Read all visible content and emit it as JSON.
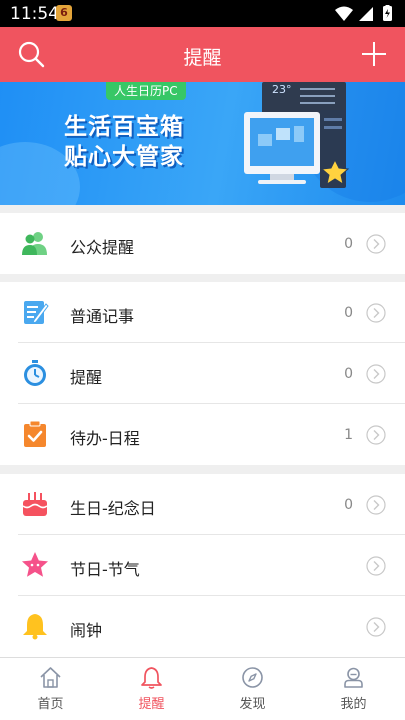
{
  "status_bar": {
    "time": "11:54",
    "notification_badge": "6"
  },
  "header": {
    "title": "提醒",
    "search_icon": "search-icon",
    "add_icon": "plus-icon"
  },
  "banner": {
    "tag": "人生日历PC",
    "line1": "生活百宝箱",
    "line2": "贴心大管家",
    "clock_text": "23°"
  },
  "sections": [
    {
      "items": [
        {
          "label": "公众提醒",
          "count": "0",
          "icon": "people-icon"
        }
      ]
    },
    {
      "items": [
        {
          "label": "普通记事",
          "count": "0",
          "icon": "notepad-icon"
        },
        {
          "label": "提醒",
          "count": "0",
          "icon": "stopwatch-icon"
        },
        {
          "label": "待办-日程",
          "count": "1",
          "icon": "clipboard-check-icon"
        }
      ]
    },
    {
      "items": [
        {
          "label": "生日-纪念日",
          "count": "0",
          "icon": "cake-icon"
        },
        {
          "label": "节日-节气",
          "count": "",
          "icon": "star-icon"
        },
        {
          "label": "闹钟",
          "count": "",
          "icon": "bell-icon"
        }
      ]
    }
  ],
  "tabbar": {
    "tabs": [
      {
        "label": "首页",
        "icon": "home-icon"
      },
      {
        "label": "提醒",
        "icon": "bell-icon",
        "active": true
      },
      {
        "label": "发现",
        "icon": "compass-icon"
      },
      {
        "label": "我的",
        "icon": "user-icon"
      }
    ]
  },
  "colors": {
    "accent": "#f0545f",
    "banner": "#1f8ff5"
  }
}
